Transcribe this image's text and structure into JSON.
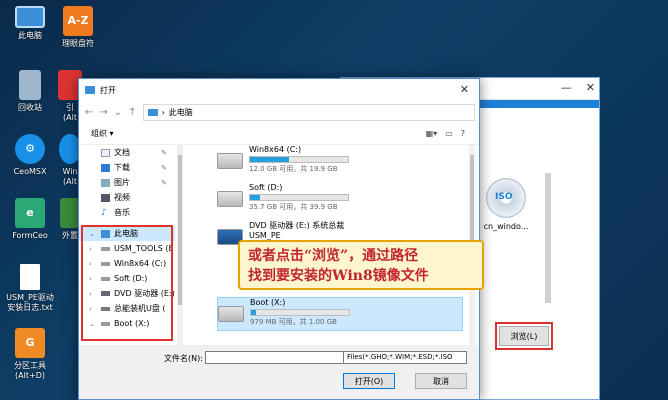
{
  "desktop": {
    "icons": [
      {
        "label": "此电脑",
        "icon": "computer-icon"
      },
      {
        "label": "理眼盘符",
        "icon": "az-icon"
      },
      {
        "label": "回收站",
        "icon": "recycle-bin-icon"
      },
      {
        "label": "引\n(Alt",
        "icon": "app-icon"
      },
      {
        "label": "CeoMSX",
        "icon": "ceomsx-icon"
      },
      {
        "label": "Win\n(Alt",
        "icon": "app-icon"
      },
      {
        "label": "FormCeo",
        "icon": "formceo-icon"
      },
      {
        "label": "外置",
        "icon": "app-icon"
      },
      {
        "label": "USM_PE驱动\n安装日志.txt",
        "icon": "text-file-icon"
      },
      {
        "label": "分区工具\n(Alt+D)",
        "icon": "partition-tool-icon"
      }
    ]
  },
  "bg_app": {
    "iso_label": "cn_windo...",
    "iso_badge": "ISO",
    "browse_button": "浏览(L)"
  },
  "dialog": {
    "title": "打开",
    "breadcrumb": "此电脑",
    "organize": "组织 ▾",
    "nav_items": [
      {
        "label": "文档",
        "pinned": true
      },
      {
        "label": "下载",
        "pinned": true
      },
      {
        "label": "图片",
        "pinned": true
      },
      {
        "label": "视频",
        "pinned": false
      },
      {
        "label": "音乐",
        "pinned": false
      },
      {
        "label": "此电脑",
        "pinned": false
      },
      {
        "label": "USM_TOOLS (E",
        "pinned": false
      },
      {
        "label": "Win8x64 (C:)",
        "pinned": false
      },
      {
        "label": "Soft (D:)",
        "pinned": false
      },
      {
        "label": "DVD 驱动器 (E:)",
        "pinned": false
      },
      {
        "label": "总能装机U盘 (",
        "pinned": false
      },
      {
        "label": "Boot (X:)",
        "pinned": false
      }
    ],
    "drives": [
      {
        "name": "Win8x64 (C:)",
        "size": "12.0 GB 可用，共 19.9 GB",
        "used": 0.4
      },
      {
        "name": "Soft (D:)",
        "size": "35.7 GB 可用，共 39.9 GB",
        "used": 0.1
      },
      {
        "name": "DVD 驱动器 (E:) 系统总裁\nUSM_PE",
        "size": "",
        "used": null
      },
      {
        "name": "Boot (X:)",
        "size": "979 MB 可用，共 1.00 GB",
        "used": 0.05
      }
    ],
    "filename_label": "文件名(N):",
    "filename_value": "",
    "filter": "Files(*.GHO;*.WIM;*.ESD;*.ISO",
    "open_button": "打开(O)",
    "cancel_button": "取消"
  },
  "callout": {
    "line1": "或者点击“浏览”，通过路径",
    "line2": "找到要安装的Win8镜像文件"
  },
  "colors": {
    "accent": "#1e7fd6",
    "highlight": "#e03030",
    "callout_text": "#c0262d"
  }
}
